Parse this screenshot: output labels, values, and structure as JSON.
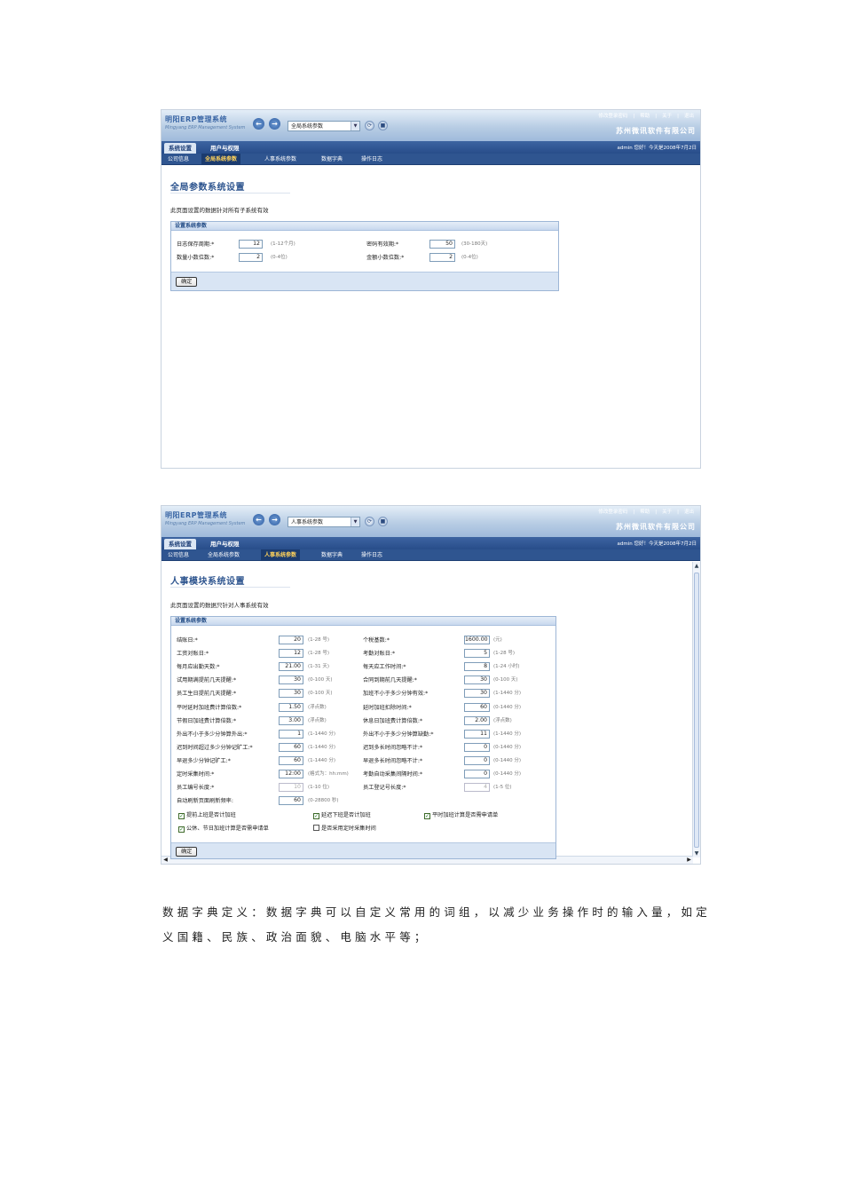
{
  "app": {
    "logo_title": "明阳ERP管理系统",
    "logo_subtitle": "Mingyang ERP Management System",
    "links": [
      "修改登录密码",
      "|",
      "帮助",
      "|",
      "关于",
      "|",
      "退出"
    ],
    "company": "苏州微讯软件有限公司",
    "greeting": "admin 您好！今天是2008年7月2日",
    "main_tabs": [
      "系统设置",
      "用户与权限"
    ],
    "sub_tabs": [
      "公司信息",
      "全局系统参数",
      "人事系统参数",
      "数据字典",
      "操作日志"
    ],
    "refresh_glyph": "⟳",
    "stop_glyph": "■"
  },
  "shot1": {
    "selector": "全局系统参数",
    "page_title": "全局参数系统设置",
    "page_desc": "此页面设置的数据针对所有子系统有效",
    "fieldset_title": "设置系统参数",
    "fields": [
      {
        "label": "日志保存周期:*",
        "value": "12",
        "hint": "(1-12个月)"
      },
      {
        "label": "密码有效期:*",
        "value": "50",
        "hint": "(30-180天)"
      },
      {
        "label": "数量小数位数:*",
        "value": "2",
        "hint": "(0-4位)"
      },
      {
        "label": "金额小数位数:*",
        "value": "2",
        "hint": "(0-4位)"
      }
    ],
    "submit": "确定"
  },
  "shot2": {
    "selector": "人事系统参数",
    "page_title": "人事模块系统设置",
    "page_desc": "此页面设置的数据只针对人事系统有效",
    "fieldset_title": "设置系统参数",
    "left": [
      {
        "label": "结账日:*",
        "value": "20",
        "hint": "(1-28 号)"
      },
      {
        "label": "工资对账日:*",
        "value": "12",
        "hint": "(1-28 号)"
      },
      {
        "label": "每月应出勤天数:*",
        "value": "21.00",
        "hint": "(1-31 天)"
      },
      {
        "label": "试用期满提前几天提醒:*",
        "value": "30",
        "hint": "(0-100 天)"
      },
      {
        "label": "员工生日提前几天提醒:*",
        "value": "30",
        "hint": "(0-100 天)"
      },
      {
        "label": "平时延时加班费计算倍数:*",
        "value": "1.50",
        "hint": "(浮点数)"
      },
      {
        "label": "节假日加班费计算倍数:*",
        "value": "3.00",
        "hint": "(浮点数)"
      },
      {
        "label": "外出不小于多少分钟算外出:*",
        "value": "1",
        "hint": "(1-1440 分)"
      },
      {
        "label": "迟到时间超过多少分钟记旷工:*",
        "value": "60",
        "hint": "(1-1440 分)"
      },
      {
        "label": "早退多少分钟记旷工:*",
        "value": "60",
        "hint": "(1-1440 分)"
      },
      {
        "label": "定时采集时间:*",
        "value": "12:00",
        "hint": "(格式为：hh:mm)"
      },
      {
        "label": "员工编号长度:*",
        "value": "10",
        "hint": "(1-10 位)",
        "disabled": true
      },
      {
        "label": "自动刷新页面刷新频率:",
        "value": "60",
        "hint": "(0-28800 秒)"
      }
    ],
    "right": [
      {
        "label": "个税基数:*",
        "value": "1600.00",
        "hint": "(元)"
      },
      {
        "label": "考勤对账日:*",
        "value": "5",
        "hint": "(1-28 号)"
      },
      {
        "label": "每天应工作时间:*",
        "value": "8",
        "hint": "(1-24 小时)"
      },
      {
        "label": "合同到期前几天提醒:*",
        "value": "30",
        "hint": "(0-100 天)"
      },
      {
        "label": "加班不小于多少分钟有效:*",
        "value": "30",
        "hint": "(1-1440 分)"
      },
      {
        "label": "延时加班扣除时间:*",
        "value": "60",
        "hint": "(0-1440 分)"
      },
      {
        "label": "休息日加班费计算倍数:*",
        "value": "2.00",
        "hint": "(浮点数)"
      },
      {
        "label": "外出不小于多少分钟算缺勤:*",
        "value": "11",
        "hint": "(1-1440 分)"
      },
      {
        "label": "迟到多长时间忽略不计:*",
        "value": "0",
        "hint": "(0-1440 分)"
      },
      {
        "label": "早退多长时间忽略不计:*",
        "value": "0",
        "hint": "(0-1440 分)"
      },
      {
        "label": "考勤自动采集间隔时间:*",
        "value": "0",
        "hint": "(0-1440 分)"
      },
      {
        "label": "员工登记号长度:*",
        "value": "4",
        "hint": "(1-5 位)",
        "disabled": true
      }
    ],
    "checks": [
      {
        "label": "提前上班是否计加班",
        "checked": true
      },
      {
        "label": "延迟下班是否计加班",
        "checked": true
      },
      {
        "label": "平时加班计算是否需申请单",
        "checked": true
      },
      {
        "label": "公休、节日加班计算是否需申请单",
        "checked": true
      },
      {
        "label": "是否采用定时采集时间",
        "checked": false
      }
    ],
    "check_glyph": "✓",
    "submit": "确定"
  },
  "paragraph": {
    "line1": "数据字典定义：数据字典可以自定义常用的词组，以减少业务操作时的输入量，如定",
    "line2": "义国籍、民族、政治面貌、电脑水平等；"
  }
}
